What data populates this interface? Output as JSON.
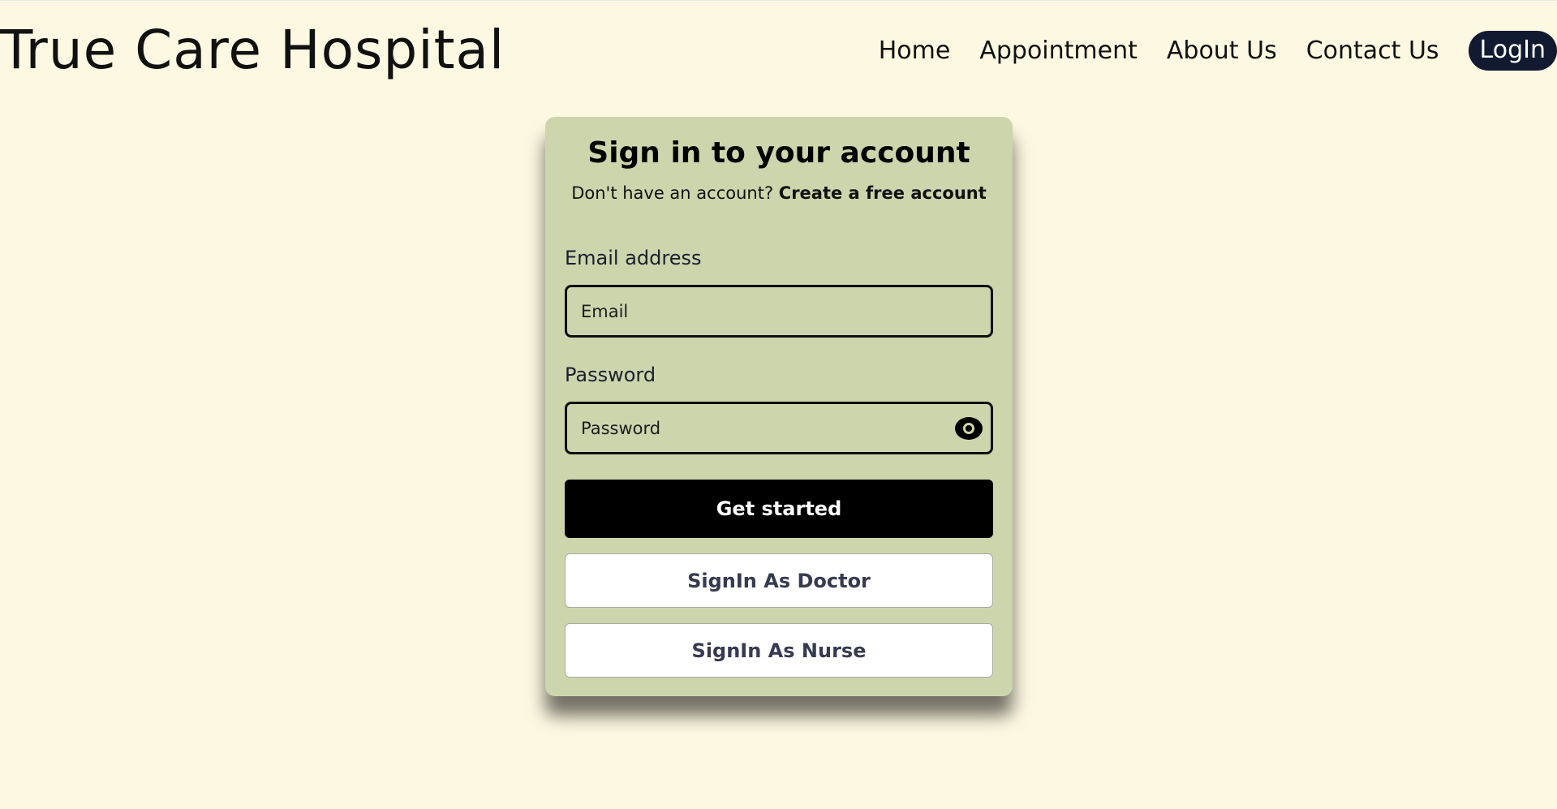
{
  "header": {
    "brand": "True Care Hospital",
    "nav": {
      "home": "Home",
      "appointment": "Appointment",
      "about": "About Us",
      "contact": "Contact Us",
      "login": "LogIn"
    }
  },
  "signin": {
    "title": "Sign in to your account",
    "subtitle_prefix": "Don't have an account?",
    "create_link": "Create a free account",
    "email_label": "Email address",
    "email_placeholder": "Email",
    "password_label": "Password",
    "password_placeholder": "Password",
    "password_toggle_icon": "eye-icon",
    "submit_label": "Get started",
    "doctor_label": "SignIn As Doctor",
    "nurse_label": "SignIn As Nurse"
  },
  "colors": {
    "page_background": "#fdf8e1",
    "card_background": "#cdd5ad",
    "login_button": "#111a30",
    "primary_button": "#000000",
    "secondary_button": "#ffffff"
  }
}
